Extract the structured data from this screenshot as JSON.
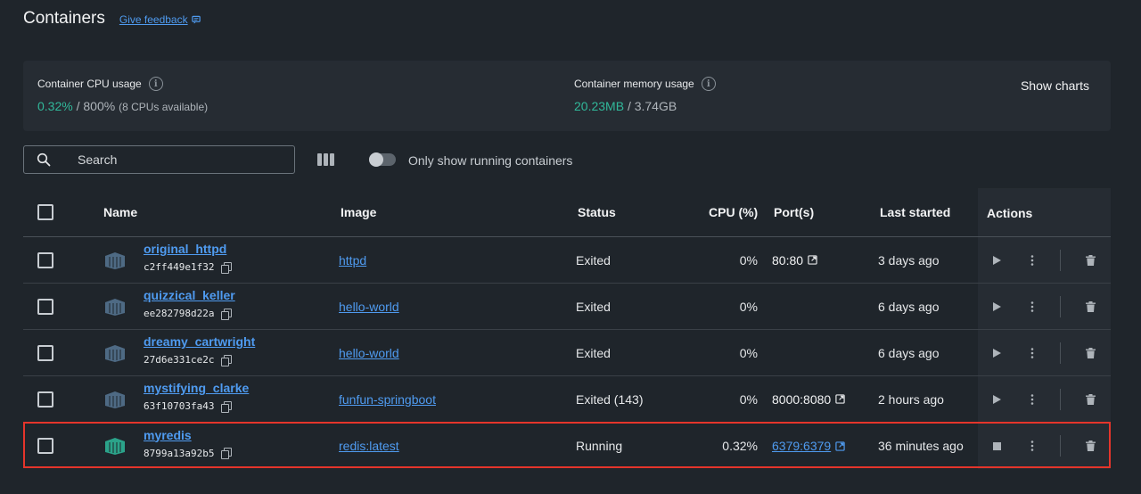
{
  "header": {
    "title": "Containers",
    "feedback": "Give feedback"
  },
  "usage": {
    "cpu": {
      "label": "Container CPU usage",
      "used": "0.32%",
      "separator": "/",
      "total": "800%",
      "note": "(8 CPUs available)"
    },
    "memory": {
      "label": "Container memory usage",
      "used": "20.23MB",
      "separator": "/",
      "total": "3.74GB"
    },
    "show_charts": "Show charts"
  },
  "toolbar": {
    "search_placeholder": "Search",
    "running_toggle_label": "Only show running containers",
    "running_only": false
  },
  "table": {
    "headers": {
      "name": "Name",
      "image": "Image",
      "status": "Status",
      "cpu": "CPU (%)",
      "ports": "Port(s)",
      "last_started": "Last started",
      "actions": "Actions"
    },
    "rows": [
      {
        "name": "original_httpd",
        "id": "c2ff449e1f32",
        "image": "httpd",
        "status": "Exited",
        "cpu": "0%",
        "ports": "80:80",
        "ports_link": false,
        "last_started": "3 days ago",
        "running": false
      },
      {
        "name": "quizzical_keller",
        "id": "ee282798d22a",
        "image": "hello-world",
        "status": "Exited",
        "cpu": "0%",
        "ports": "",
        "ports_link": false,
        "last_started": "6 days ago",
        "running": false
      },
      {
        "name": "dreamy_cartwright",
        "id": "27d6e331ce2c",
        "image": "hello-world",
        "status": "Exited",
        "cpu": "0%",
        "ports": "",
        "ports_link": false,
        "last_started": "6 days ago",
        "running": false
      },
      {
        "name": "mystifying_clarke",
        "id": "63f10703fa43",
        "image": "funfun-springboot",
        "status": "Exited (143)",
        "cpu": "0%",
        "ports": "8000:8080",
        "ports_link": false,
        "last_started": "2 hours ago",
        "running": false
      },
      {
        "name": "myredis",
        "id": "8799a13a92b5",
        "image": "redis:latest",
        "status": "Running",
        "cpu": "0.32%",
        "ports": "6379:6379",
        "ports_link": true,
        "last_started": "36 minutes ago",
        "running": true
      }
    ]
  },
  "colors": {
    "background": "#1f252b",
    "accent_link": "#4f9bf0",
    "usage_green": "#31b89a",
    "container_stopped": "#4e6a84",
    "container_running": "#2ba38a",
    "highlight": "#e5352b"
  },
  "icons": {
    "feedback": "feedback-icon",
    "info": "info-icon",
    "search": "search-icon",
    "columns": "columns-icon",
    "container": "container-icon",
    "copy": "copy-icon",
    "external": "external-link-icon",
    "start": "play-icon",
    "stop": "stop-icon",
    "more": "more-vertical-icon",
    "delete": "trash-icon"
  }
}
